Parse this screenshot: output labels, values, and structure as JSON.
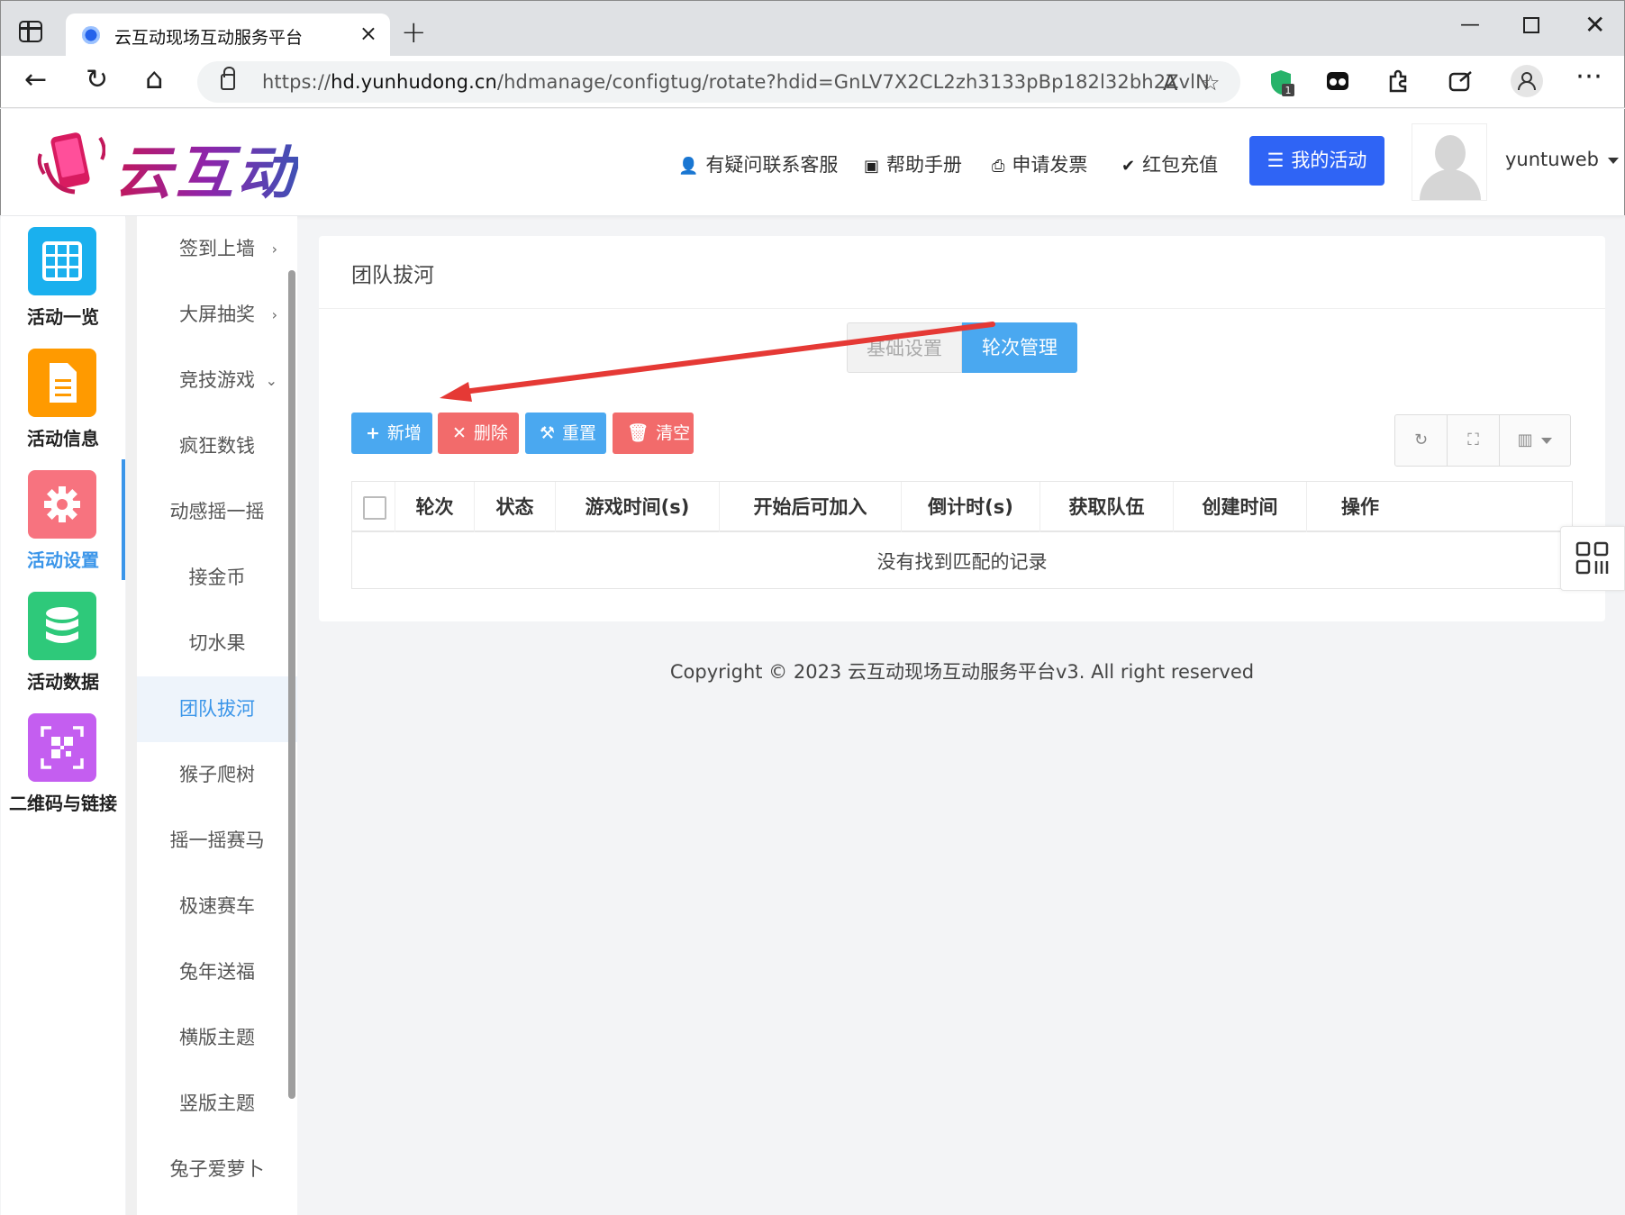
{
  "browser": {
    "tab_title": "云互动现场互动服务平台",
    "url_prefix": "https://",
    "url_host": "hd.yunhudong.cn",
    "url_path": "/hdmanage/configtug/rotate?hdid=GnLV7X2CL2zh3133pBp182l32bh2ZvlN",
    "extension_badge": "1"
  },
  "header": {
    "logo_text": "云互动",
    "links": {
      "support": "有疑问联系客服",
      "manual": "帮助手册",
      "invoice": "申请发票",
      "recharge": "红包充值"
    },
    "my_activity": "我的活动",
    "username": "yuntuweb"
  },
  "sidebar": {
    "items": [
      {
        "label": "活动一览",
        "color": "#1ab0ee",
        "icon": "grid-icon"
      },
      {
        "label": "活动信息",
        "color": "#ff9a00",
        "icon": "document-icon"
      },
      {
        "label": "活动设置",
        "color": "#f7737f",
        "icon": "gear-icon"
      },
      {
        "label": "活动数据",
        "color": "#2ec97a",
        "icon": "database-icon"
      },
      {
        "label": "二维码与链接",
        "color": "#c45ef0",
        "icon": "qrcode-icon"
      }
    ],
    "active_index": 2
  },
  "submenu": {
    "items": [
      {
        "label": "签到上墙",
        "chev": "›"
      },
      {
        "label": "大屏抽奖",
        "chev": "›"
      },
      {
        "label": "竞技游戏",
        "chev": "⌄"
      },
      {
        "label": "疯狂数钱"
      },
      {
        "label": "动感摇一摇"
      },
      {
        "label": "接金币"
      },
      {
        "label": "切水果"
      },
      {
        "label": "团队拔河"
      },
      {
        "label": "猴子爬树"
      },
      {
        "label": "摇一摇赛马"
      },
      {
        "label": "极速赛车"
      },
      {
        "label": "兔年送福"
      },
      {
        "label": "横版主题"
      },
      {
        "label": "竖版主题"
      },
      {
        "label": "兔子爱萝卜"
      }
    ],
    "active_label": "团队拔河"
  },
  "panel": {
    "title": "团队拔河",
    "tabs": {
      "basic": "基础设置",
      "rounds": "轮次管理"
    },
    "toolbar": {
      "add": "新增",
      "delete": "删除",
      "reset": "重置",
      "clear": "清空"
    },
    "columns": [
      "轮次",
      "状态",
      "游戏时间(s)",
      "开始后可加入",
      "倒计时(s)",
      "获取队伍",
      "创建时间",
      "操作"
    ],
    "empty_text": "没有找到匹配的记录"
  },
  "footer": {
    "copyright": "Copyright © 2023 云互动现场互动服务平台v3. All right reserved"
  },
  "colors": {
    "primary": "#4aa8f0",
    "danger": "#f26b6b",
    "my_activity_bg": "#2f64f5",
    "annotation_arrow": "#e53935"
  }
}
